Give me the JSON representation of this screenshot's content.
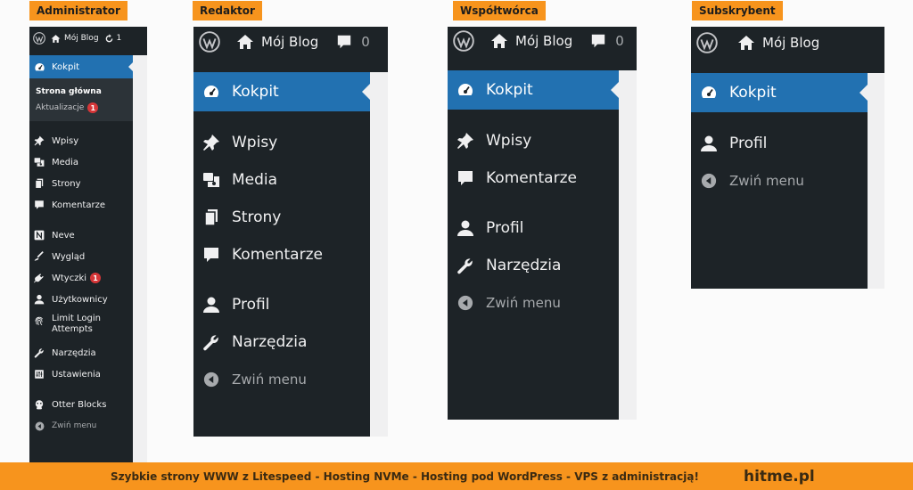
{
  "colors": {
    "accent_orange": "#f7941d",
    "admin_bg": "#1d2327",
    "active_blue": "#2271b1",
    "badge_red": "#d63638",
    "muted_text": "#a7aaad"
  },
  "admin": {
    "role_label": "Administrator",
    "adminbar": {
      "site": "Mój Blog",
      "updates_count": "1"
    },
    "active_item": "Kokpit",
    "submenu": {
      "home": "Strona główna",
      "updates": "Aktualizacje",
      "updates_badge": "1"
    },
    "items": {
      "wpisy": "Wpisy",
      "media": "Media",
      "strony": "Strony",
      "komentarze": "Komentarze",
      "neve": "Neve",
      "wyglad": "Wygląd",
      "wtyczki": "Wtyczki",
      "wtyczki_badge": "1",
      "uzytkownicy": "Użytkownicy",
      "limit_login": "Limit Login Attempts",
      "narzedzia": "Narzędzia",
      "ustawienia": "Ustawienia",
      "otter": "Otter Blocks",
      "collapse": "Zwiń menu"
    }
  },
  "redaktor": {
    "role_label": "Redaktor",
    "adminbar": {
      "site": "Mój Blog",
      "comments_count": "0"
    },
    "items": {
      "kokpit": "Kokpit",
      "wpisy": "Wpisy",
      "media": "Media",
      "strony": "Strony",
      "komentarze": "Komentarze",
      "profil": "Profil",
      "narzedzia": "Narzędzia",
      "collapse": "Zwiń menu"
    }
  },
  "wspol": {
    "role_label": "Współtwórca",
    "adminbar": {
      "site": "Mój Blog",
      "comments_count": "0"
    },
    "items": {
      "kokpit": "Kokpit",
      "wpisy": "Wpisy",
      "komentarze": "Komentarze",
      "profil": "Profil",
      "narzedzia": "Narzędzia",
      "collapse": "Zwiń menu"
    }
  },
  "subskr": {
    "role_label": "Subskrybent",
    "adminbar": {
      "site": "Mój Blog"
    },
    "items": {
      "kokpit": "Kokpit",
      "profil": "Profil",
      "collapse": "Zwiń menu"
    }
  },
  "footer": {
    "promo": "Szybkie strony WWW z Litespeed - Hosting  NVMe - Hosting pod WordPress - VPS z administracją!",
    "brand": "hitme.pl"
  }
}
